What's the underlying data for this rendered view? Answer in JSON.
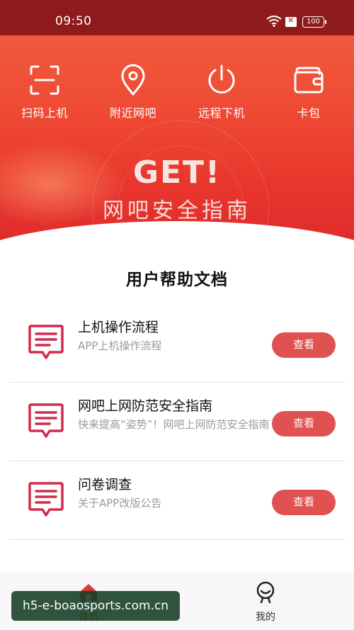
{
  "status_bar": {
    "time": "09:50",
    "battery": "100"
  },
  "quick_actions": [
    {
      "label": "扫码上机",
      "icon": "scan-icon"
    },
    {
      "label": "附近网吧",
      "icon": "location-icon"
    },
    {
      "label": "远程下机",
      "icon": "power-icon"
    },
    {
      "label": "卡包",
      "icon": "wallet-icon"
    }
  ],
  "banner": {
    "headline": "GET!",
    "subtitle": "网吧安全指南"
  },
  "help": {
    "title": "用户帮助文档",
    "items": [
      {
        "title": "上机操作流程",
        "subtitle": "APP上机操作流程",
        "button": "查看"
      },
      {
        "title": "网吧上网防范安全指南",
        "subtitle": "快来提高“姿势”！网吧上网防范安全指南",
        "button": "查看"
      },
      {
        "title": "问卷调查",
        "subtitle": "关于APP改版公告",
        "button": "查看"
      }
    ]
  },
  "tabs": [
    {
      "label": "首页",
      "icon": "home-icon",
      "active": true
    },
    {
      "label": "我的",
      "icon": "user-icon",
      "active": false
    }
  ],
  "watermark": "h5-e-boaosports.com.cn",
  "colors": {
    "accent": "#e05252",
    "hero": "#e8352d",
    "status_bar": "#8e1b1b"
  }
}
